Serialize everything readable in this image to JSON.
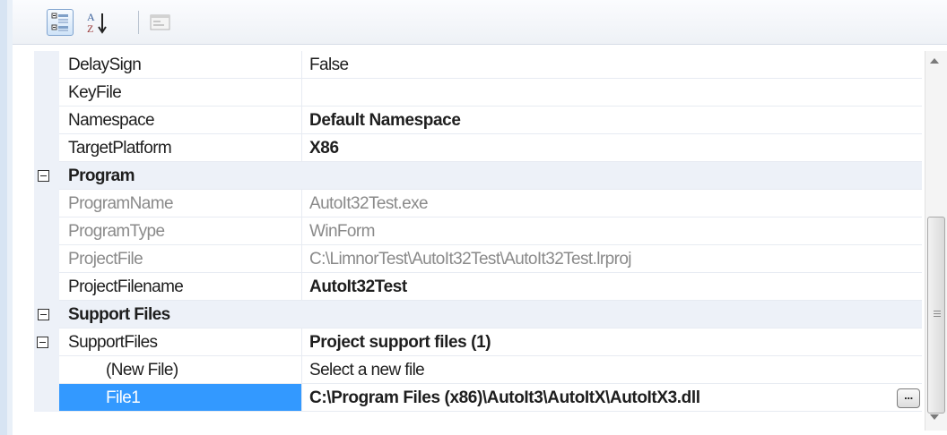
{
  "toolbar": {
    "categorized_icon": "categorized-view-icon",
    "alphabetical_label": "A↓Z",
    "property_pages_icon": "property-pages-icon"
  },
  "rows": [
    {
      "name": "DelaySign",
      "value": "False"
    },
    {
      "name": "KeyFile",
      "value": ""
    },
    {
      "name": "Namespace",
      "value": "Default Namespace"
    },
    {
      "name": "TargetPlatform",
      "value": "X86"
    },
    {
      "category": "Program"
    },
    {
      "name": "ProgramName",
      "value": "AutoIt32Test.exe"
    },
    {
      "name": "ProgramType",
      "value": "WinForm"
    },
    {
      "name": "ProjectFile",
      "value": "C:\\LimnorTest\\AutoIt32Test\\AutoIt32Test.lrproj"
    },
    {
      "name": "ProjectFilename",
      "value": "AutoIt32Test"
    },
    {
      "category": "Support Files"
    },
    {
      "name": "SupportFiles",
      "value": "Project support files (1)"
    },
    {
      "name": "(New File)",
      "value": "Select a new file"
    },
    {
      "name": "File1",
      "value": "C:\\Program Files (x86)\\AutoIt3\\AutoItX\\AutoItX3.dll"
    }
  ],
  "ellipsis_label": "..."
}
